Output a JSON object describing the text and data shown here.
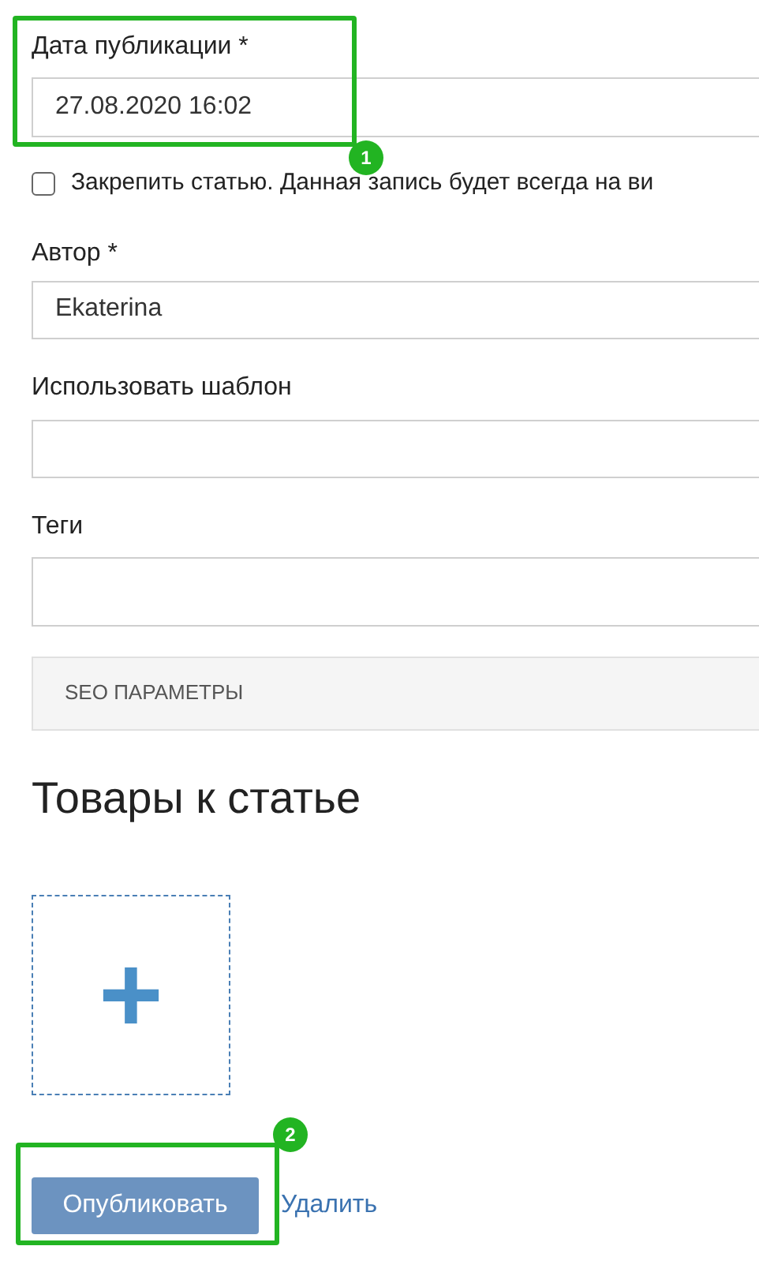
{
  "publish_date": {
    "label": "Дата публикации *",
    "value": "27.08.2020 16:02"
  },
  "pin": {
    "checked": false,
    "label": "Закрепить статью. Данная запись будет всегда на ви"
  },
  "author": {
    "label": "Автор *",
    "value": "Ekaterina"
  },
  "template": {
    "label": "Использовать шаблон"
  },
  "tags": {
    "label": "Теги"
  },
  "seo_section": {
    "label": "SEO ПАРАМЕТРЫ"
  },
  "products": {
    "title": "Товары к статье",
    "add_button": "+"
  },
  "actions": {
    "publish": "Опубликовать",
    "delete": "Удалить"
  },
  "annotations": [
    {
      "number": "1"
    },
    {
      "number": "2"
    }
  ]
}
